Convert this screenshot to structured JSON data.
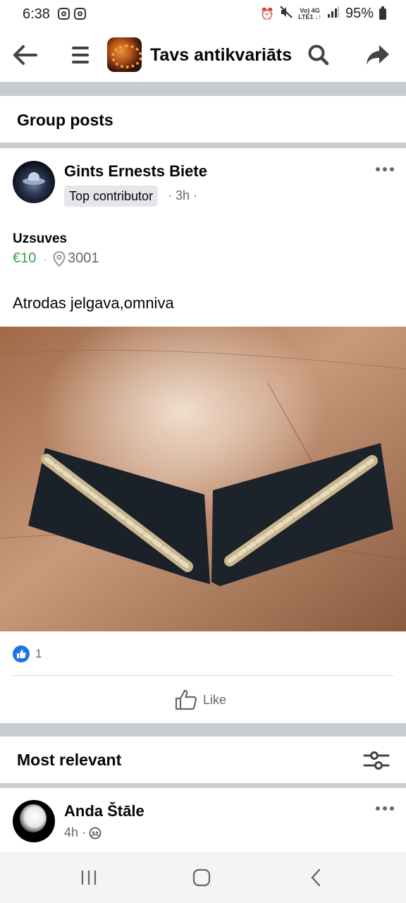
{
  "status_bar": {
    "time": "6:38",
    "network_line1": "Vo) 4G",
    "network_line2": "LTE1 ↓↑",
    "battery": "95%"
  },
  "app_bar": {
    "title": "Tavs antikvariāts",
    "icons": [
      "back-arrow-icon",
      "menu-icon",
      "search-icon",
      "share-icon"
    ]
  },
  "group_posts": {
    "heading": "Group posts"
  },
  "post": {
    "author": "Gints Ernests Biete",
    "badge": "Top contributor",
    "time": "· 3h ·",
    "item_title": "Uzsuves",
    "price": "€10",
    "separator": "·",
    "location": "3001",
    "text": "Atrodas jelgava,omniva",
    "reaction_count": "1",
    "like_label": "Like"
  },
  "comments": {
    "heading": "Most relevant",
    "items": [
      {
        "name": "Anda Štāle",
        "time": "4h ·"
      }
    ]
  },
  "colors": {
    "price_green": "#42a14a",
    "like_blue": "#1b74e4",
    "separator_gray": "#c9ccd1",
    "text_secondary": "#65676b"
  }
}
